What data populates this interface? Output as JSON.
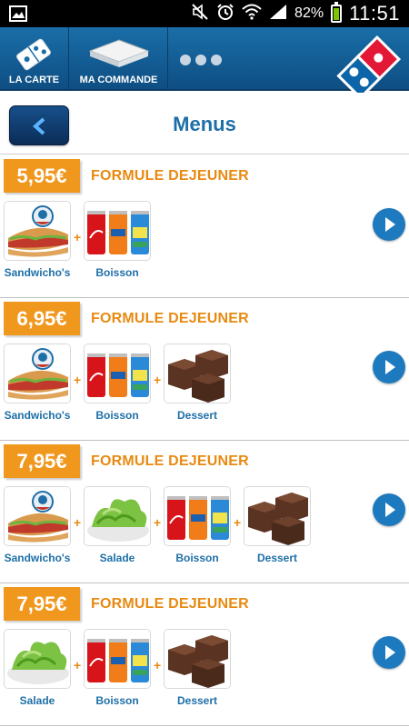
{
  "status_bar": {
    "battery": "82%",
    "time": "11:51"
  },
  "nav": {
    "tabs": [
      {
        "label": "LA CARTE"
      },
      {
        "label": "MA COMMANDE"
      }
    ]
  },
  "page": {
    "title": "Menus"
  },
  "formules": [
    {
      "price": "5,95€",
      "title": "FORMULE DEJEUNER",
      "items": [
        {
          "label": "Sandwicho's",
          "icon": "sandwich"
        },
        {
          "label": "Boisson",
          "icon": "drinks"
        }
      ]
    },
    {
      "price": "6,95€",
      "title": "FORMULE DEJEUNER",
      "items": [
        {
          "label": "Sandwicho's",
          "icon": "sandwich"
        },
        {
          "label": "Boisson",
          "icon": "drinks"
        },
        {
          "label": "Dessert",
          "icon": "brownies"
        }
      ]
    },
    {
      "price": "7,95€",
      "title": "FORMULE DEJEUNER",
      "items": [
        {
          "label": "Sandwicho's",
          "icon": "sandwich"
        },
        {
          "label": "Salade",
          "icon": "salad"
        },
        {
          "label": "Boisson",
          "icon": "drinks"
        },
        {
          "label": "Dessert",
          "icon": "brownies"
        }
      ]
    },
    {
      "price": "7,95€",
      "title": "FORMULE DEJEUNER",
      "items": [
        {
          "label": "Salade",
          "icon": "salad"
        },
        {
          "label": "Boisson",
          "icon": "drinks"
        },
        {
          "label": "Dessert",
          "icon": "brownies"
        }
      ]
    }
  ]
}
